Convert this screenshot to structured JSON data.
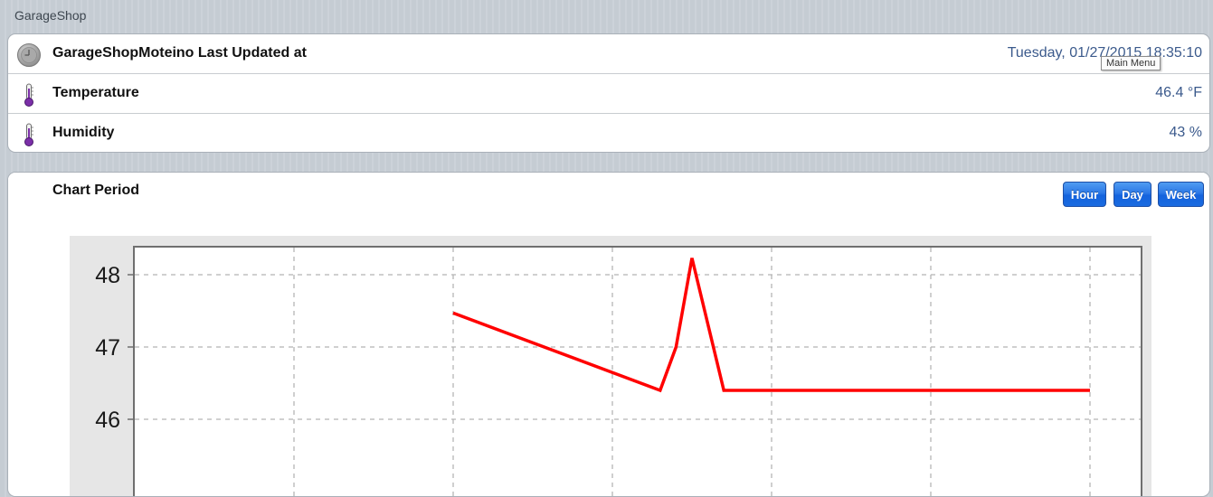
{
  "app": {
    "title": "GarageShop"
  },
  "status": {
    "updated_label": "GarageShopMoteino Last Updated at",
    "updated_value": "Tuesday, 01/27/2015 18:35:10",
    "temperature_label": "Temperature",
    "temperature_value": "46.4 °F",
    "humidity_label": "Humidity",
    "humidity_value": "43 %",
    "icons": [
      "clock-icon",
      "thermometer-icon",
      "thermometer-icon"
    ]
  },
  "tooltip": {
    "text": "Main Menu"
  },
  "chart_period": {
    "label": "Chart Period",
    "buttons": [
      "Hour",
      "Day",
      "Week"
    ],
    "button_color": "#1a6be0"
  },
  "chart_data": {
    "type": "line",
    "title": "",
    "xlabel": "",
    "ylabel": "",
    "y_ticks": [
      "48",
      "47",
      "46"
    ],
    "grid": true,
    "series": [
      {
        "color": "#ff0000",
        "x": [
          2.0,
          3.3,
          3.4,
          3.5,
          3.7,
          6.0
        ],
        "y": [
          47.47,
          46.4,
          47.0,
          48.23,
          46.4,
          46.4
        ]
      }
    ]
  }
}
